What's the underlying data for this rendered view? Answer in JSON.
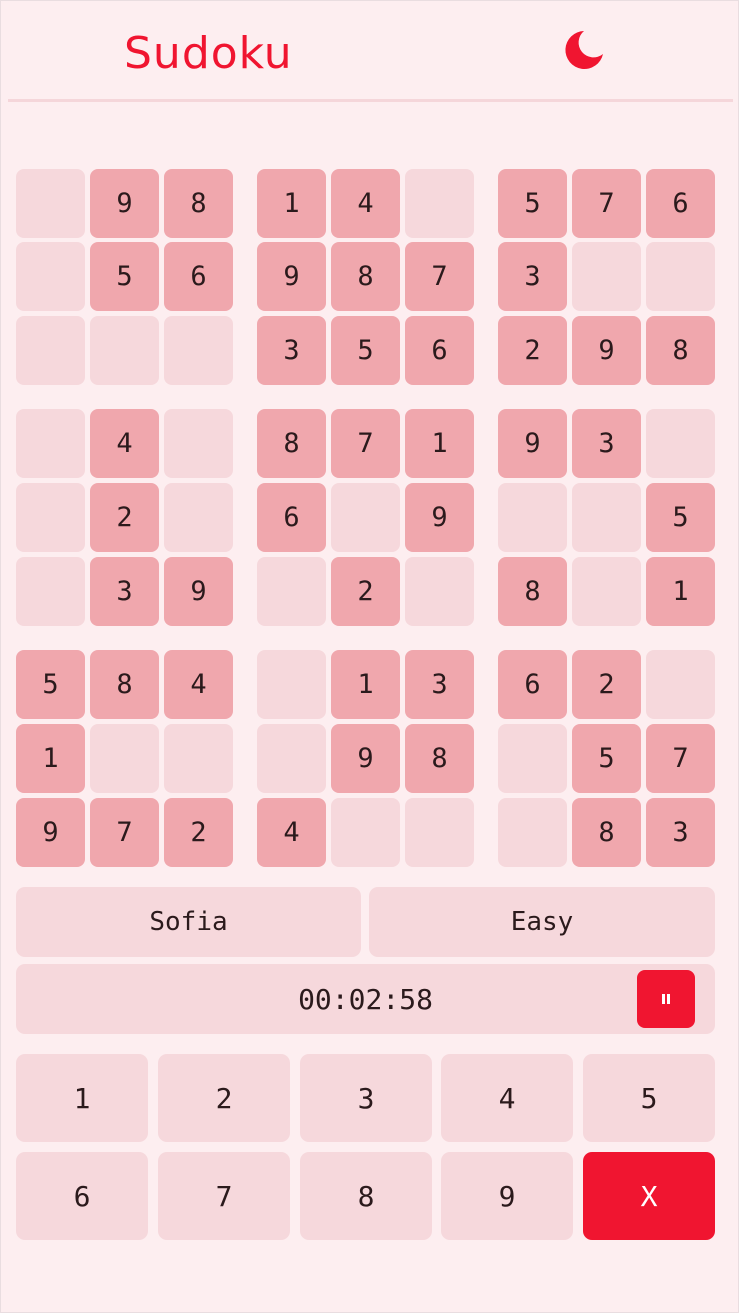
{
  "header": {
    "title": "Sudoku",
    "theme_toggle_icon": "moon-icon"
  },
  "colors": {
    "accent": "#f01530",
    "background": "#fdeef0",
    "cell_empty": "#f6d8dc",
    "cell_given": "#f0a7ad"
  },
  "board": [
    [
      "",
      "9",
      "8",
      "1",
      "4",
      "",
      "5",
      "7",
      "6"
    ],
    [
      "",
      "5",
      "6",
      "9",
      "8",
      "7",
      "3",
      "",
      ""
    ],
    [
      "",
      "",
      "",
      "3",
      "5",
      "6",
      "2",
      "9",
      "8"
    ],
    [
      "",
      "4",
      "",
      "8",
      "7",
      "1",
      "9",
      "3",
      ""
    ],
    [
      "",
      "2",
      "",
      "6",
      "",
      "9",
      "",
      "",
      "5"
    ],
    [
      "",
      "3",
      "9",
      "",
      "2",
      "",
      "8",
      "",
      "1"
    ],
    [
      "5",
      "8",
      "4",
      "",
      "1",
      "3",
      "6",
      "2",
      ""
    ],
    [
      "1",
      "",
      "",
      "",
      "9",
      "8",
      "",
      "5",
      "7"
    ],
    [
      "9",
      "7",
      "2",
      "4",
      "",
      "",
      "",
      "8",
      "3"
    ]
  ],
  "player": {
    "name": "Sofia"
  },
  "difficulty": {
    "label": "Easy"
  },
  "timer": {
    "value": "00:02:58",
    "pause_icon": "pause-icon"
  },
  "keypad": {
    "digits": [
      "1",
      "2",
      "3",
      "4",
      "5",
      "6",
      "7",
      "8",
      "9"
    ],
    "erase_label": "X"
  }
}
